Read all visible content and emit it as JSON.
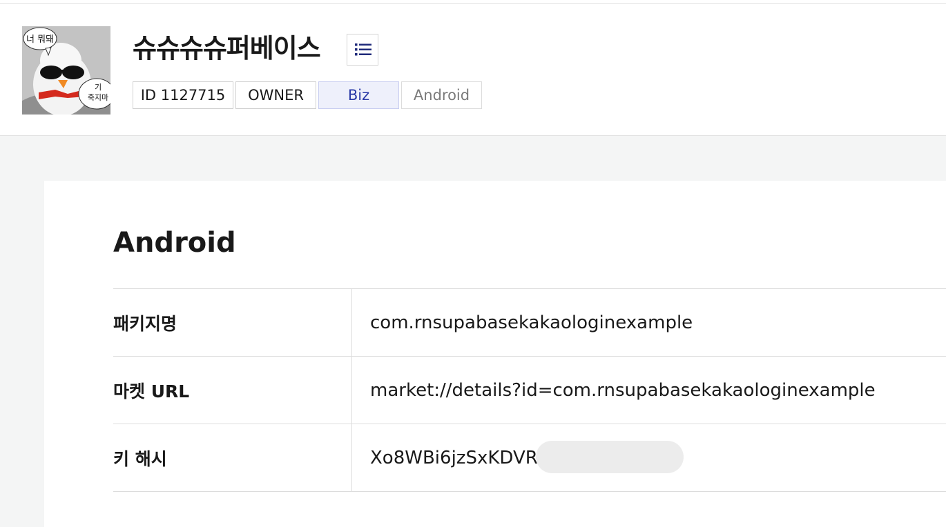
{
  "app": {
    "name": "슈슈슈슈퍼베이스",
    "icon_speech_top": "너 뭐돼",
    "icon_speech_bottom_1": "기",
    "icon_speech_bottom_2": "죽지마",
    "menu_icon": "list-icon"
  },
  "badges": [
    {
      "label": "ID 1127715"
    },
    {
      "label": "OWNER"
    },
    {
      "label": "Biz"
    },
    {
      "label": "Android"
    }
  ],
  "section": {
    "title": "Android",
    "rows": [
      {
        "label": "패키지명",
        "value": "com.rnsupabasekakaologinexample"
      },
      {
        "label": "마켓 URL",
        "value": "market://details?id=com.rnsupabasekakaologinexample"
      },
      {
        "label": "키 해시",
        "value": "Xo8WBi6jzSxKDVR4"
      }
    ]
  },
  "colors": {
    "biz_badge_bg": "#eef0fb",
    "biz_badge_text": "#2a3aa7",
    "menu_icon": "#1f2a7a",
    "page_bg": "#f4f5f5"
  }
}
